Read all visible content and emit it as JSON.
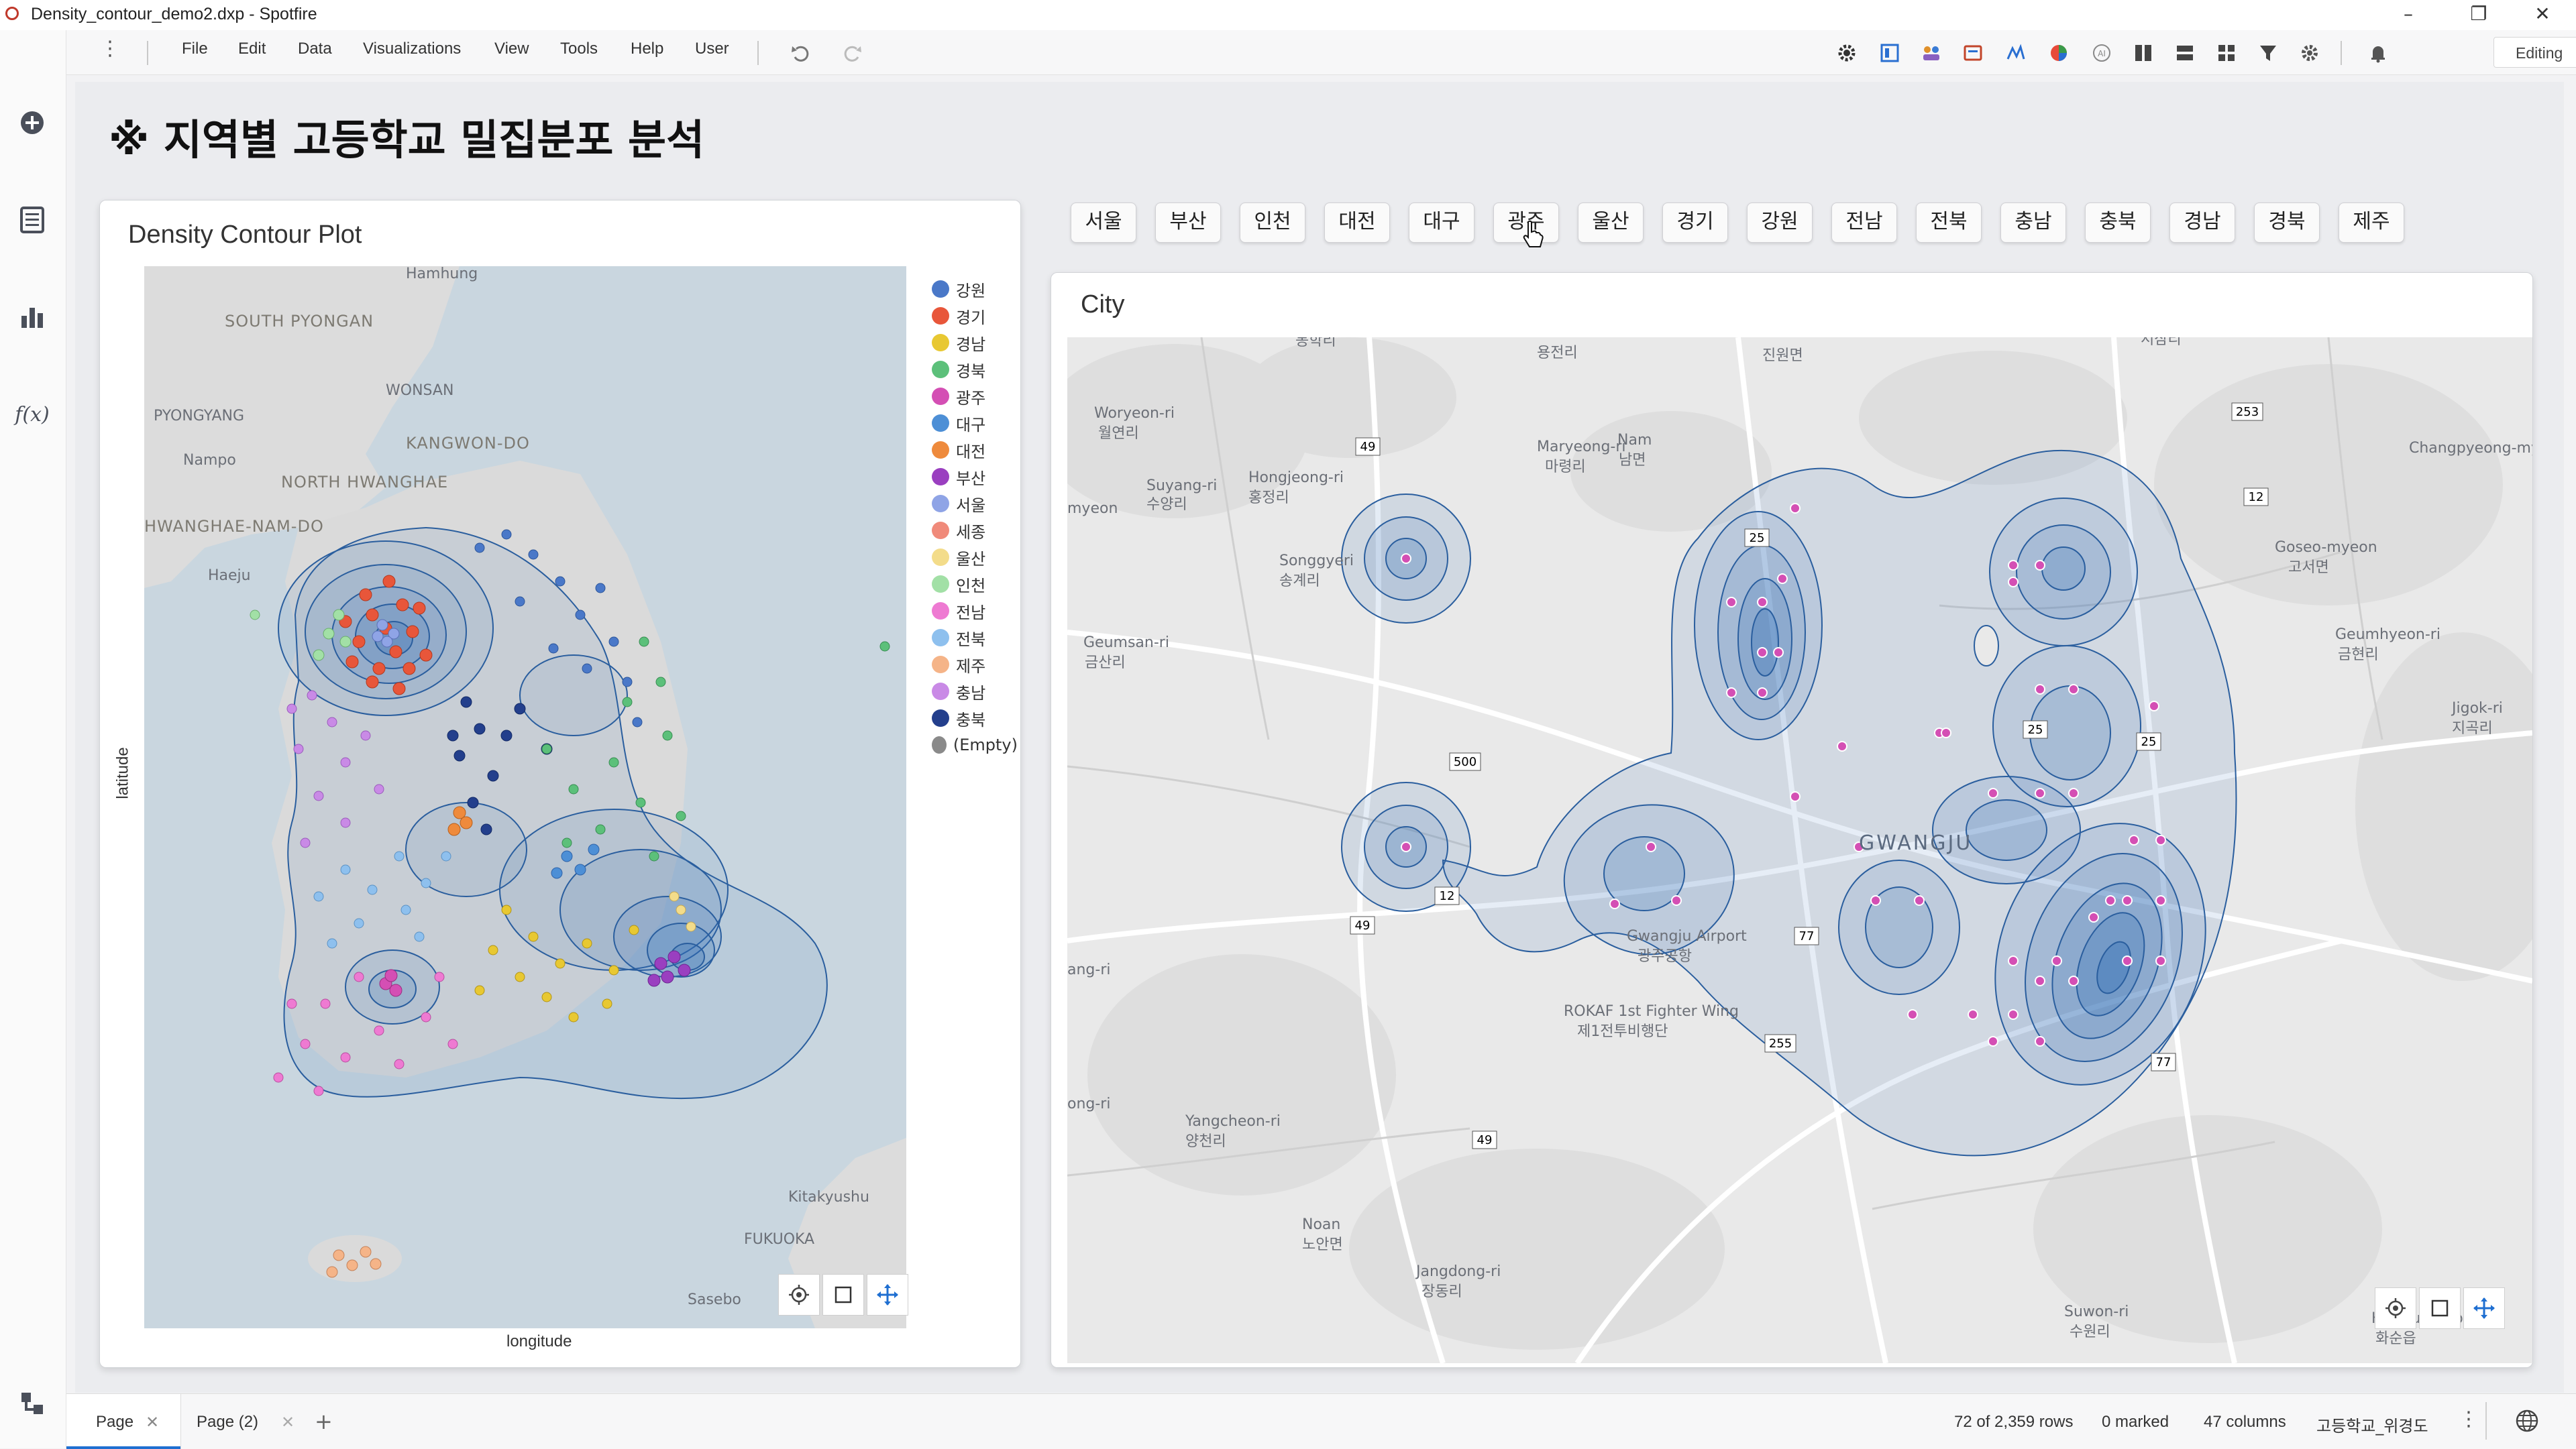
{
  "window": {
    "title": "Density_contour_demo2.dxp - Spotfire",
    "minimize": "–",
    "restore": "❐",
    "close": "✕"
  },
  "menu": {
    "items": [
      "File",
      "Edit",
      "Data",
      "Visualizations",
      "View",
      "Tools",
      "Help",
      "User"
    ],
    "mode": "Editing"
  },
  "page": {
    "heading": "※ 지역별 고등학교 밀집분포 분석"
  },
  "left_panel": {
    "title": "Density Contour Plot",
    "xlabel": "longitude",
    "ylabel": "latitude",
    "legend": [
      {
        "label": "강원",
        "color": "#4a78c8"
      },
      {
        "label": "경기",
        "color": "#e8563a"
      },
      {
        "label": "경남",
        "color": "#e8c832"
      },
      {
        "label": "경북",
        "color": "#5cc07a"
      },
      {
        "label": "광주",
        "color": "#d44fb4"
      },
      {
        "label": "대구",
        "color": "#4d8fd6"
      },
      {
        "label": "대전",
        "color": "#ee8a3c"
      },
      {
        "label": "부산",
        "color": "#9a3fc0"
      },
      {
        "label": "서울",
        "color": "#8fa4e6"
      },
      {
        "label": "세종",
        "color": "#f08a7a"
      },
      {
        "label": "울산",
        "color": "#f3dc8a"
      },
      {
        "label": "인천",
        "color": "#a2e0a6"
      },
      {
        "label": "전남",
        "color": "#ee7ad2"
      },
      {
        "label": "전북",
        "color": "#8ec0ee"
      },
      {
        "label": "제주",
        "color": "#f5b488"
      },
      {
        "label": "충남",
        "color": "#c98ae6"
      },
      {
        "label": "충북",
        "color": "#233f8c"
      },
      {
        "label": "(Empty)",
        "color": "#8a8a8a"
      }
    ],
    "map_labels": [
      "Hamhung",
      "SOUTH PYONGAN",
      "WONSAN",
      "PYONGYANG",
      "KANGWON-DO",
      "Nampo",
      "NORTH HWANGHAE",
      "HWANGHAE-NAM-DO",
      "Haeju",
      "Kitakyushu",
      "FUKUOKA",
      "Sasebo"
    ]
  },
  "city_tabs": [
    "서울",
    "부산",
    "인천",
    "대전",
    "대구",
    "광주",
    "울산",
    "경기",
    "강원",
    "전남",
    "전북",
    "충남",
    "충북",
    "경남",
    "경북",
    "제주"
  ],
  "right_panel": {
    "title": "City",
    "map_labels": {
      "gwangju": "GWANGJU",
      "airport": "Gwangju Airport",
      "airport_ko": "광주공항",
      "airbase": "ROKAF 1st Fighter Wing",
      "airbase_ko": "제1전투비행단",
      "woryeon": "Woryeon-ri",
      "woryeon_ko": "월연리",
      "maryeong": "Maryeong-ri",
      "maryeong_ko": "마령리",
      "nam": "Nam",
      "nam_ko": "남면",
      "hongjeong": "Hongjeong-ri",
      "hongjeong_ko": "홍정리",
      "suyang": "Suyang-ri",
      "suyang_ko": "수양리",
      "songgyeri": "Songgyeri",
      "songgye_ko": "송계리",
      "myeon": "myeon",
      "geumsan": "Geumsan-ri",
      "geumsan_ko": "금산리",
      "changpyeong": "Changpyeong-myeon",
      "goseo": "Goseo-myeon",
      "goseo_ko": "고서면",
      "geumhyeon": "Geumhyeon-ri",
      "geumhyeon_ko": "금현리",
      "jigok": "Jigok-ri",
      "jigok_ko": "지곡리",
      "yangcheon": "Yangcheon-ri",
      "yangcheon_ko": "양천리",
      "noan": "Noan",
      "noan_ko": "노안면",
      "jangdong": "Jangdong-ri",
      "jangdong_ko": "장동리",
      "suwon": "Suwon-ri",
      "suwon_ko": "수원리",
      "hwasun": "Hwasun-eup",
      "hwasun_ko": "화순읍",
      "angri": "ang-ri",
      "ongri": "ong-ri",
      "jinwon": "진원면",
      "yongjeon": "용전리",
      "bonghak": "봉학리",
      "seosam": "서삼리"
    },
    "road_shields": [
      "49",
      "500",
      "49",
      "12",
      "25",
      "25",
      "25",
      "77",
      "255",
      "77",
      "49",
      "253",
      "12"
    ]
  },
  "status": {
    "tabs": [
      {
        "label": "Page",
        "close": "✕"
      },
      {
        "label": "Page (2)",
        "close": "✕"
      }
    ],
    "add": "+",
    "rows": "72 of 2,359 rows",
    "marked": "0 marked",
    "columns": "47 columns",
    "table": "고등학교_위경도"
  },
  "colors": {
    "accent": "#1f6fd1",
    "density": "#2f6db5",
    "marker": "#d44fb4"
  }
}
